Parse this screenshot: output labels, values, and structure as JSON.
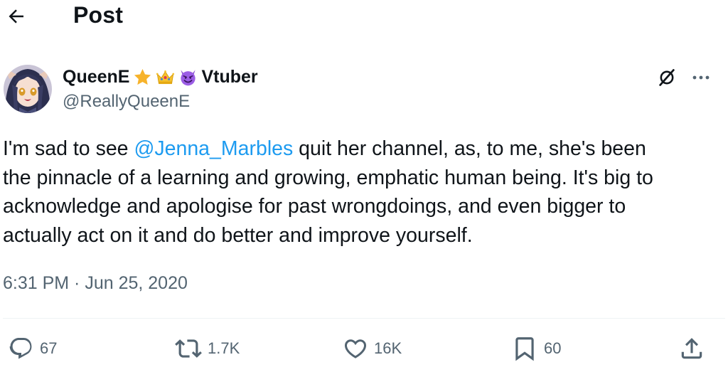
{
  "header": {
    "back_icon": "arrow-left-icon",
    "title": "Post"
  },
  "author": {
    "display_name": "QueenE",
    "name_emojis": [
      "star-emoji",
      "crown-emoji",
      "smiling-devil-emoji"
    ],
    "name_suffix": "Vtuber",
    "handle": "@ReallyQueenE",
    "avatar": "anime-avatar",
    "grok_icon": "grok-icon",
    "more_icon": "more-dots-icon"
  },
  "tweet": {
    "lines": [
      {
        "before": "I'm sad to see ",
        "mention": "@Jenna_Marbles",
        "after": " quit her channel, as, to me, she's been"
      },
      {
        "text": "the pinnacle of a learning and growing, emphatic human being. It's big to"
      },
      {
        "text": "acknowledge and apologise for past wrongdoings, and even bigger to"
      },
      {
        "text": "actually act on it and do better and improve yourself."
      }
    ],
    "timestamp": "6:31 PM · Jun 25, 2020"
  },
  "actions": {
    "replies": "67",
    "reposts": "1.7K",
    "likes": "16K",
    "bookmarks": "60",
    "icons": [
      "reply-icon",
      "repost-icon",
      "like-icon",
      "bookmark-icon",
      "share-icon"
    ]
  },
  "colors": {
    "text": "#0f1419",
    "secondary": "#536471",
    "link": "#1d9bf0",
    "divider": "#eff3f4"
  }
}
